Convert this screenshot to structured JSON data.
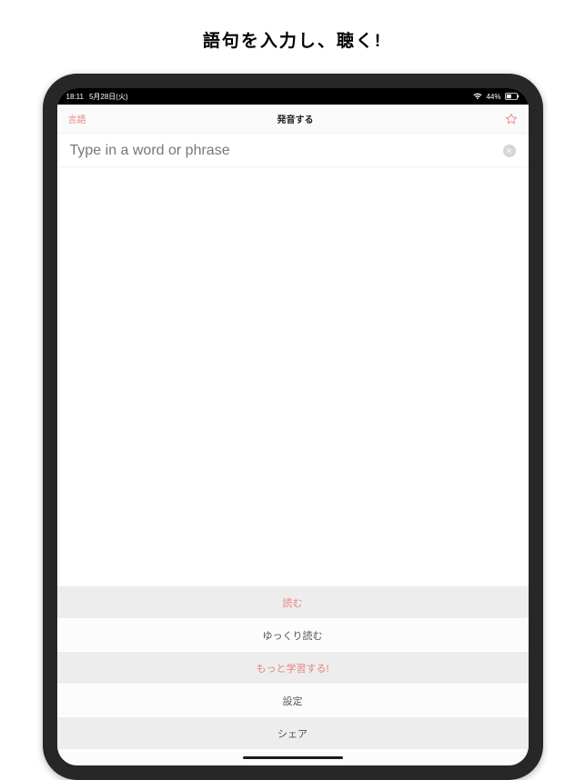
{
  "heading": "語句を入力し、聴く!",
  "status": {
    "time": "18:11",
    "date": "5月28日(火)",
    "battery_text": "44%"
  },
  "nav": {
    "left_label": "言語",
    "title": "発音する"
  },
  "input": {
    "placeholder": "Type in a word or phrase"
  },
  "actions": {
    "read": "読む",
    "read_slow": "ゆっくり読む",
    "learn_more": "もっと学習する!",
    "settings": "設定",
    "share": "シェア"
  }
}
